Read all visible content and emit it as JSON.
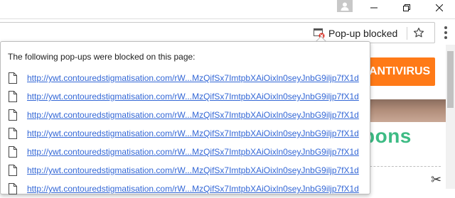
{
  "popup_bubble": {
    "indicator_label": "Pop-up blocked",
    "heading": "The following pop-ups were blocked on this page:",
    "items": [
      {
        "url": "http://ywt.contouredstigmatisation.com/rW...MzQifSx7ImtpbXAiOixln0seyJnbG9iljp7fX1d"
      },
      {
        "url": "http://ywt.contouredstigmatisation.com/rW...MzQifSx7ImtpbXAiOixln0seyJnbG9iljp7fX1d"
      },
      {
        "url": "http://ywt.contouredstigmatisation.com/rW...MzQifSx7ImtpbXAiOixln0seyJnbG9iljp7fX1d"
      },
      {
        "url": "http://ywt.contouredstigmatisation.com/rW...MzQifSx7ImtpbXAiOixln0seyJnbG9iljp7fX1d"
      },
      {
        "url": "http://ywt.contouredstigmatisation.com/rW...MzQifSx7ImtpbXAiOixln0seyJnbG9iljp7fX1d"
      },
      {
        "url": "http://ywt.contouredstigmatisation.com/rW...MzQifSx7ImtpbXAiOixln0seyJnbG9iljp7fX1d"
      },
      {
        "url": "http://ywt.contouredstigmatisation.com/rW...MzQifSx7ImtpbXAiOixln0seyJnbG9iljp7fX1d"
      }
    ]
  },
  "background_page": {
    "cta_label": "ANTIVIRUS",
    "coupons_text": "pons"
  },
  "icons": {
    "user": "user-icon",
    "minimize": "minimize-icon",
    "restore": "restore-icon",
    "close": "close-icon",
    "popup_blocked": "popup-blocked-icon",
    "bookmark": "star-icon",
    "menu": "kebab-menu-icon",
    "file": "file-icon",
    "scissors": "scissors-icon"
  },
  "colors": {
    "link": "#3367d6",
    "cta": "#ff7a17",
    "coupons": "#3dbb84",
    "blocked_badge": "#d93025"
  }
}
